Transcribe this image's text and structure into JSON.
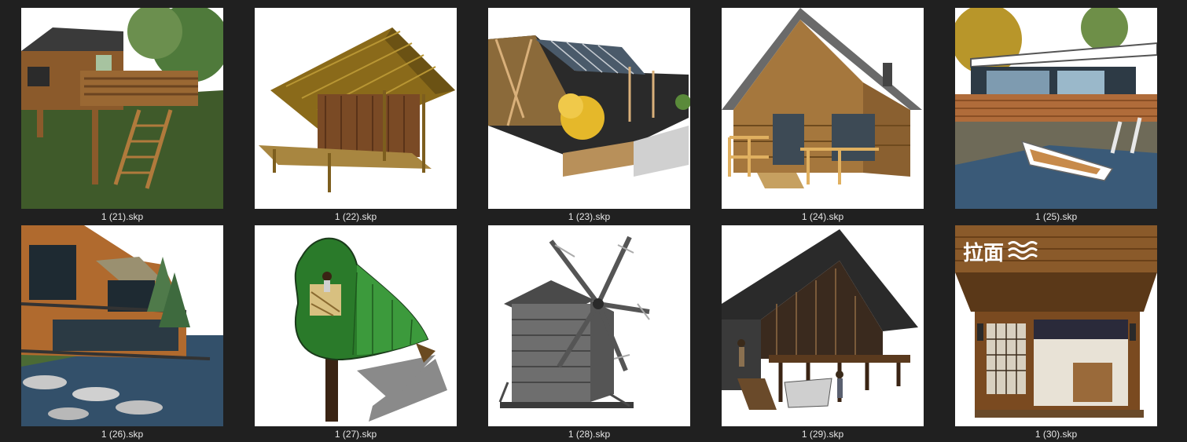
{
  "files": [
    {
      "name": "1 (21).skp",
      "icon": "treehouse-thumbnail"
    },
    {
      "name": "1 (22).skp",
      "icon": "bamboo-hut-thumbnail"
    },
    {
      "name": "1 (23).skp",
      "icon": "greenhouse-cabin-thumbnail"
    },
    {
      "name": "1 (24).skp",
      "icon": "log-cabin-thumbnail"
    },
    {
      "name": "1 (25).skp",
      "icon": "lake-house-thumbnail"
    },
    {
      "name": "1 (26).skp",
      "icon": "waterfront-villa-thumbnail"
    },
    {
      "name": "1 (27).skp",
      "icon": "leaf-treehouse-thumbnail"
    },
    {
      "name": "1 (28).skp",
      "icon": "windmill-thumbnail"
    },
    {
      "name": "1 (29).skp",
      "icon": "stilt-house-thumbnail"
    },
    {
      "name": "1 (30).skp",
      "icon": "ramen-shop-thumbnail",
      "sign": "拉面"
    }
  ],
  "colors": {
    "background": "#202020",
    "thumb_bg": "#ffffff",
    "label": "#e6e6e6"
  }
}
